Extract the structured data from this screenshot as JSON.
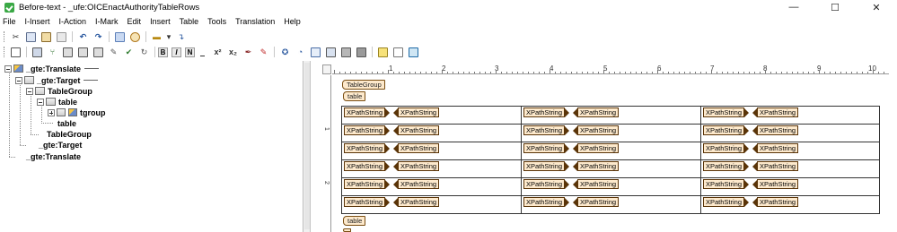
{
  "window": {
    "title": "Before-text - _ufe:OICEnactAuthorityTableRows",
    "controls": [
      "—",
      "☐",
      "✕"
    ]
  },
  "menu": [
    "File",
    "I-Insert",
    "I-Action",
    "I-Mark",
    "Edit",
    "Insert",
    "Table",
    "Tools",
    "Translation",
    "Help"
  ],
  "toolbar": {
    "format_labels": [
      "B",
      "I",
      "N",
      "x²",
      "x₂"
    ]
  },
  "tree": {
    "nodes": [
      {
        "label": "_gte:Translate",
        "level": 0
      },
      {
        "label": "_gte:Target",
        "level": 1
      },
      {
        "label": "TableGroup",
        "level": 2
      },
      {
        "label": "table",
        "level": 3
      },
      {
        "label": "tgroup",
        "level": 4
      },
      {
        "label": "table",
        "level": 3
      },
      {
        "label": "TableGroup",
        "level": 2
      },
      {
        "label": "_gte:Target",
        "level": 1
      },
      {
        "label": "_gte:Translate",
        "level": 0
      }
    ]
  },
  "ruler": {
    "inch_labels": [
      "1",
      "2",
      "3",
      "4",
      "5",
      "6",
      "7",
      "8",
      "9",
      "10"
    ],
    "vertical_labels": [
      "1",
      "2"
    ]
  },
  "editor": {
    "tag_tablegroup": "TableGroup",
    "tag_table_open": "table",
    "tag_table_close": "table",
    "cell_open": "XPathString",
    "cell_close": "XPathString",
    "rows": 6,
    "cols": 3
  }
}
